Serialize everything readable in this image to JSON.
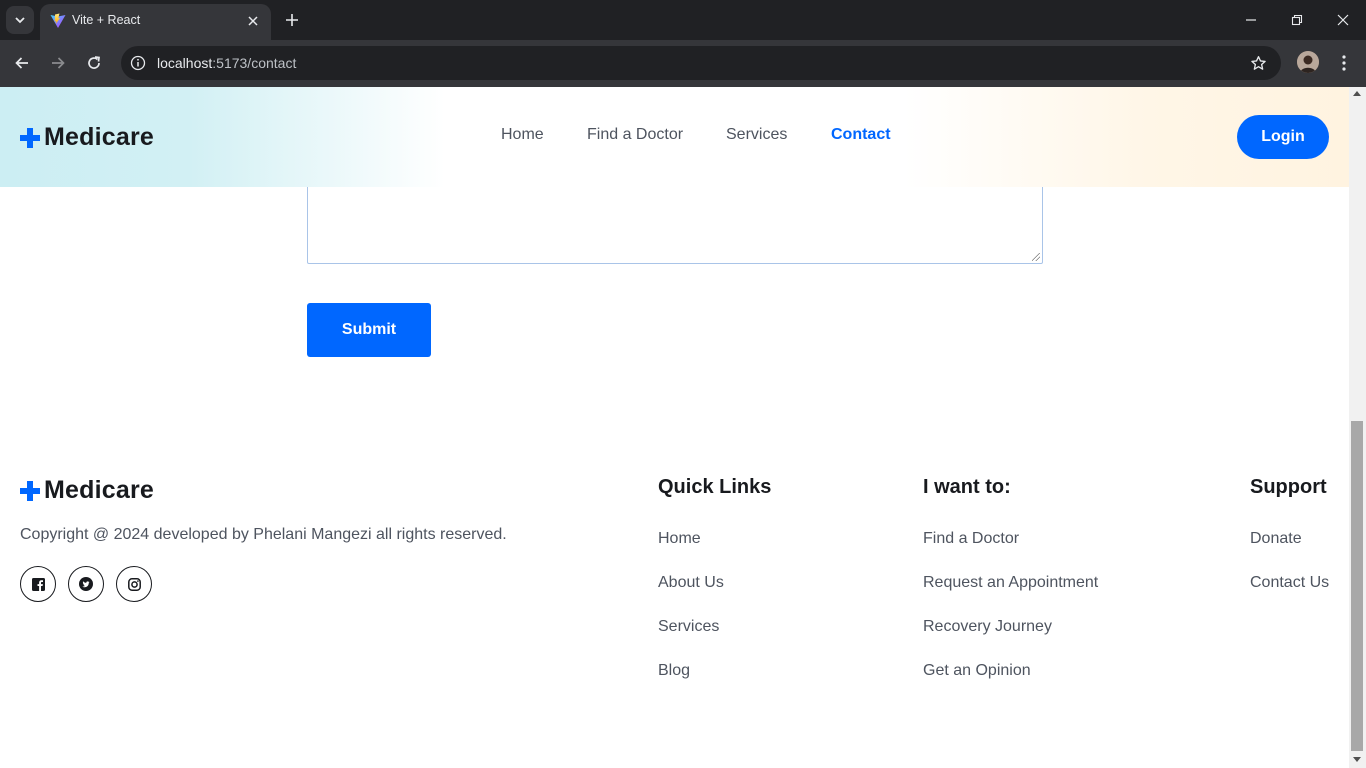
{
  "browser": {
    "tab_title": "Vite + React",
    "url_host": "localhost",
    "url_path": ":5173/contact",
    "icons": [
      "tab-list-icon",
      "vite-favicon-icon",
      "close-tab-icon",
      "new-tab-icon",
      "minimize-icon",
      "restore-icon",
      "close-window-icon",
      "back-icon",
      "forward-icon",
      "reload-icon",
      "site-info-icon",
      "bookmark-star-icon",
      "profile-avatar",
      "kebab-menu-icon"
    ]
  },
  "header": {
    "logo_text": "Medicare",
    "nav": [
      {
        "label": "Home",
        "active": false
      },
      {
        "label": "Find a Doctor",
        "active": false
      },
      {
        "label": "Services",
        "active": false
      },
      {
        "label": "Contact",
        "active": true
      }
    ],
    "login_label": "Login"
  },
  "contact_form": {
    "message_value": "",
    "submit_label": "Submit"
  },
  "footer": {
    "logo_text": "Medicare",
    "copyright": "Copyright @ 2024 developed by Phelani Mangezi all rights reserved.",
    "socials": [
      "facebook-icon",
      "twitter-icon",
      "instagram-icon"
    ],
    "quick_links": {
      "title": "Quick Links",
      "items": [
        "Home",
        "About Us",
        "Services",
        "Blog"
      ]
    },
    "i_want_to": {
      "title": "I want to:",
      "items": [
        "Find a Doctor",
        "Request an Appointment",
        "Recovery Journey",
        "Get an Opinion"
      ]
    },
    "support": {
      "title": "Support",
      "items": [
        "Donate",
        "Contact Us"
      ]
    }
  },
  "colors": {
    "primary": "#0067ff",
    "heading": "#181a1e",
    "text": "#4e545f"
  }
}
